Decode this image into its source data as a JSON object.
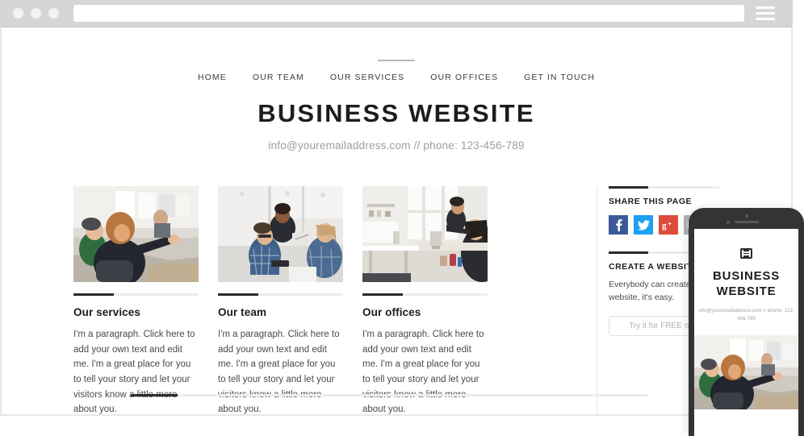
{
  "browser": {
    "dots": [
      "close-dot",
      "minimize-dot",
      "maximize-dot"
    ],
    "url_value": "",
    "url_placeholder": "",
    "menu_icon": "hamburger-icon"
  },
  "site": {
    "nav": [
      {
        "label": "HOME",
        "active": true
      },
      {
        "label": "OUR TEAM",
        "active": false
      },
      {
        "label": "OUR SERVICES",
        "active": false
      },
      {
        "label": "OUR OFFICES",
        "active": false
      },
      {
        "label": "GET IN TOUCH",
        "active": false
      }
    ],
    "title": "BUSINESS WEBSITE",
    "contact": "info@youremailaddress.com // phone: 123-456-789"
  },
  "columns": [
    {
      "title": "Our services",
      "body": "I'm a paragraph. Click here to add your own text and edit me. I'm a great place for you to tell your story and let your visitors know a little more about you.",
      "image_alt": "office-meeting-photo"
    },
    {
      "title": "Our team",
      "body": "I'm a paragraph. Click here to add your own text and edit me. I'm a great place for you to tell your story and let your visitors know a little more about you.",
      "image_alt": "team-discussion-photo"
    },
    {
      "title": "Our offices",
      "body": "I'm a paragraph. Click here to add your own text and edit me. I'm a great place for you to tell your story and let your visitors know a little more about you.",
      "image_alt": "open-office-desks-photo"
    }
  ],
  "sidebar": {
    "share": {
      "heading": "SHARE THIS PAGE",
      "icons": [
        {
          "name": "facebook-icon",
          "glyph": "f",
          "color": "#3b5998"
        },
        {
          "name": "twitter-icon",
          "glyph": "",
          "color": "#1da1f2"
        },
        {
          "name": "google-plus-icon",
          "glyph": "g+",
          "color": "#dd4b39"
        },
        {
          "name": "email-icon",
          "glyph": "",
          "color": "#b5b5b5"
        }
      ]
    },
    "create": {
      "heading": "CREATE A WEBSITE",
      "description": "Everybody can create a website, it's easy.",
      "cta_label": "Try it for FREE now",
      "cta_icon": "info-dot-icon"
    }
  },
  "phone": {
    "menu_icon": "mobile-menu-icon",
    "title": "BUSINESS WEBSITE",
    "contact": "info@youremailaddress.com // phone: 123-456-789",
    "image_alt": "office-meeting-photo"
  },
  "colors": {
    "accent_dark": "#2b2b2b",
    "rule_light": "#ececec",
    "chrome": "#d6d6d6",
    "muted_text": "#9e9e9e"
  }
}
